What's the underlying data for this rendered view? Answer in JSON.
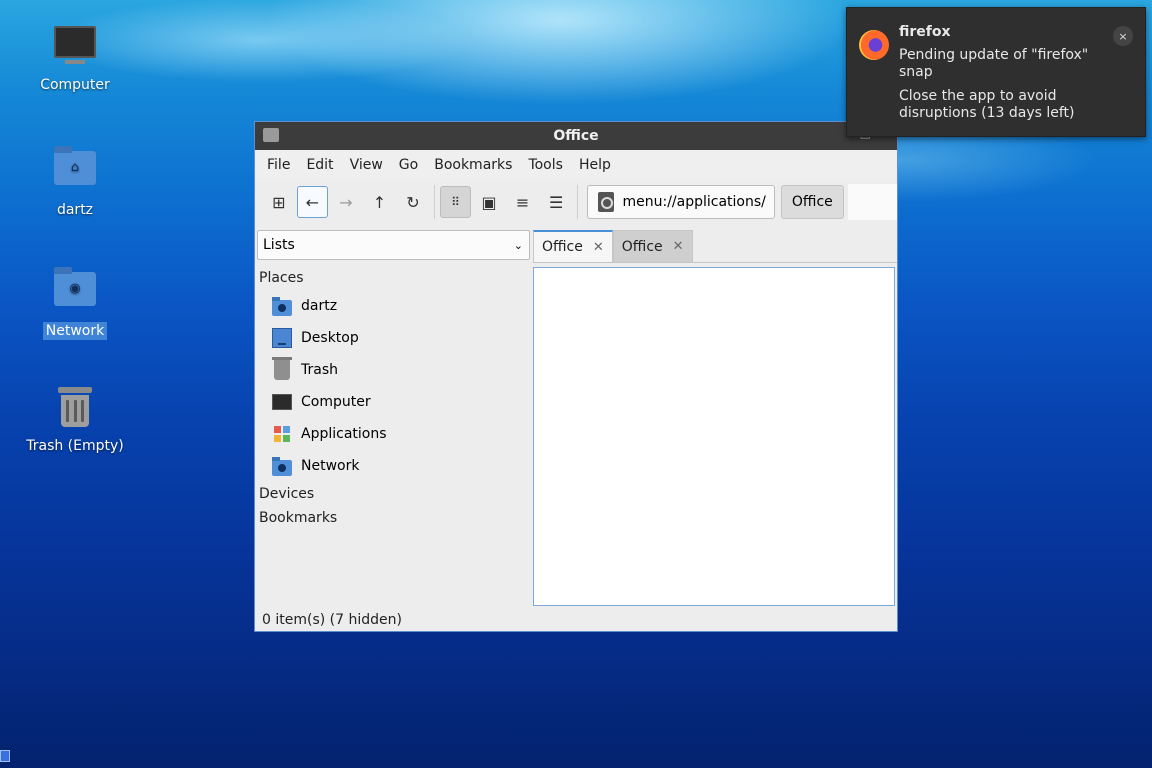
{
  "desktop": {
    "icons": [
      {
        "label": "Computer"
      },
      {
        "label": "dartz"
      },
      {
        "label": "Network"
      },
      {
        "label": "Trash (Empty)"
      }
    ]
  },
  "window": {
    "title": "Office",
    "menu": [
      "File",
      "Edit",
      "View",
      "Go",
      "Bookmarks",
      "Tools",
      "Help"
    ],
    "location": "menu://applications/",
    "breadcrumb": "Office",
    "side_mode": "Lists",
    "sections": {
      "places": "Places",
      "devices": "Devices",
      "bookmarks": "Bookmarks"
    },
    "places": [
      {
        "label": "dartz"
      },
      {
        "label": "Desktop"
      },
      {
        "label": "Trash"
      },
      {
        "label": "Computer"
      },
      {
        "label": "Applications"
      },
      {
        "label": "Network"
      }
    ],
    "tabs": [
      {
        "label": "Office"
      },
      {
        "label": "Office"
      }
    ],
    "status": "0 item(s) (7 hidden)"
  },
  "notification": {
    "app": "firefox",
    "body": "Pending update of \"firefox\" snap",
    "detail": "Close the app to avoid disruptions (13 days left)",
    "close": "×"
  }
}
